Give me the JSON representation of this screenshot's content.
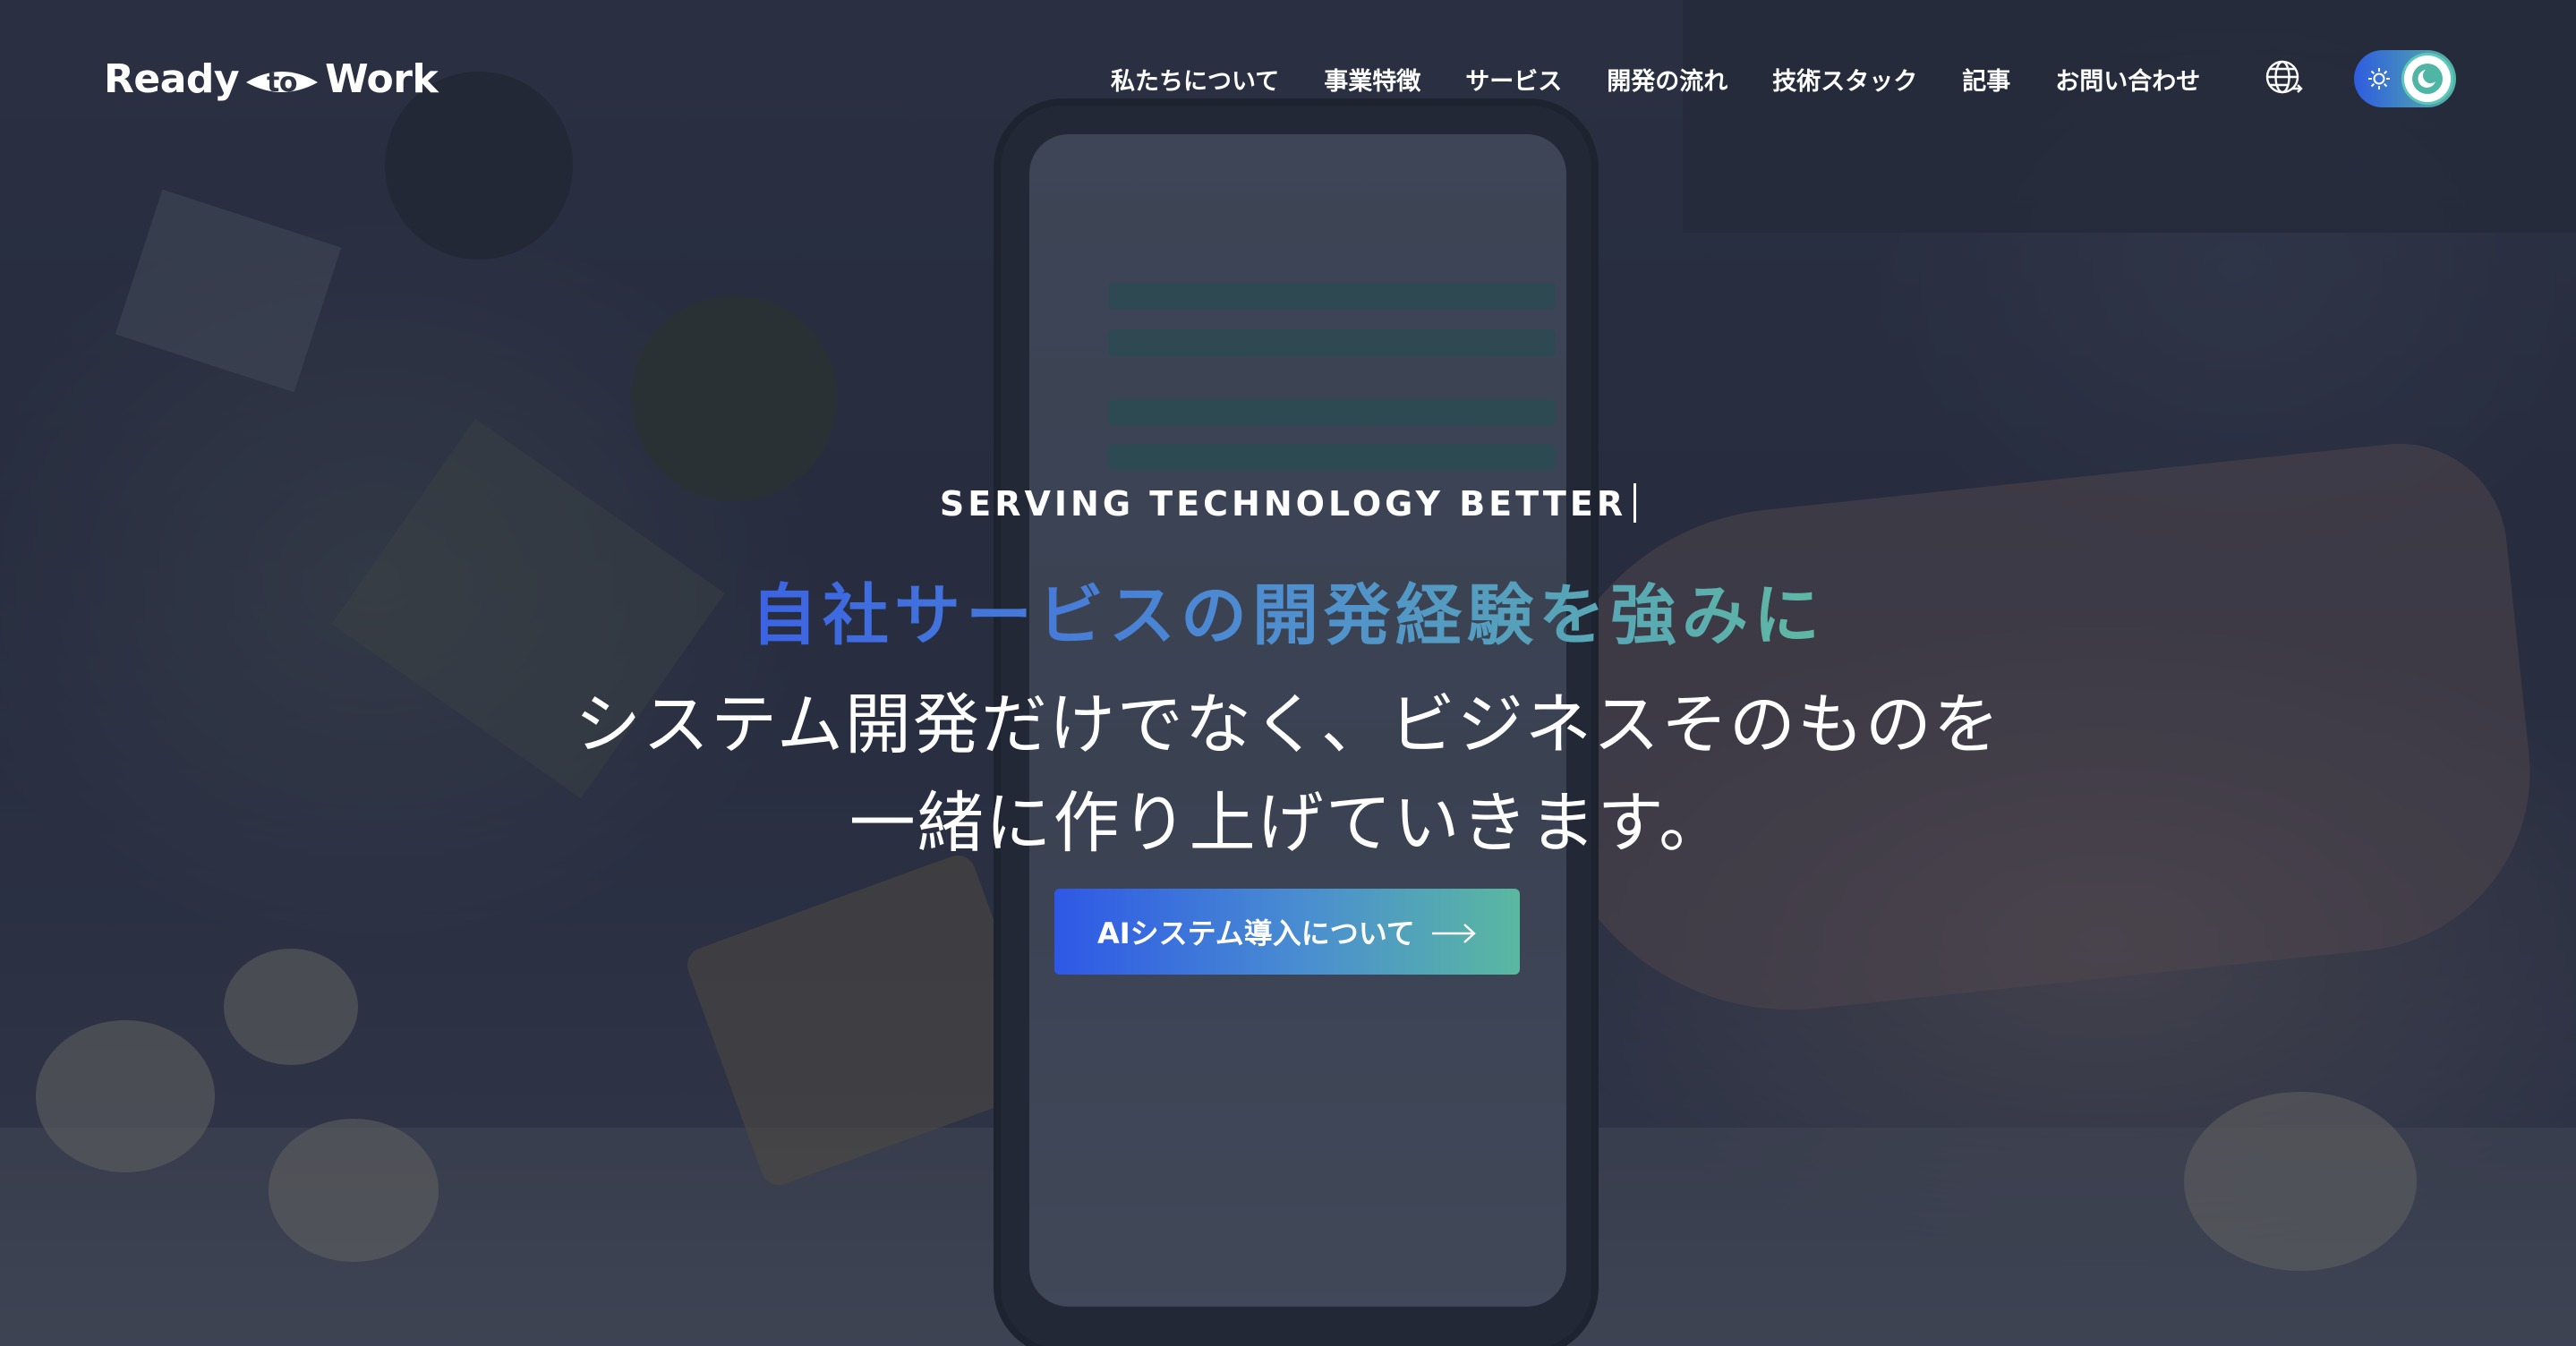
{
  "brand": {
    "name_left": "Ready",
    "name_mark": "to",
    "name_right": "Work"
  },
  "nav": {
    "items": [
      {
        "label": "私たちについて"
      },
      {
        "label": "事業特徴"
      },
      {
        "label": "サービス"
      },
      {
        "label": "開発の流れ"
      },
      {
        "label": "技術スタック"
      },
      {
        "label": "記事"
      },
      {
        "label": "お問い合わせ"
      }
    ],
    "language_icon": "globe-icon",
    "theme_toggle": {
      "light_icon": "sun-icon",
      "dark_icon": "moon-icon",
      "state": "dark"
    }
  },
  "hero": {
    "eyebrow": "SERVING TECHNOLOGY BETTER",
    "headline": "自社サービスの開発経験を強みに",
    "subline_1": "システム開発だけでなく、ビジネスそのものを",
    "subline_2": "一緒に作り上げていきます。",
    "cta_label": "AIシステム導入について",
    "cta_icon": "arrow-right-icon"
  },
  "colors": {
    "accent_blue": "#2e58e6",
    "accent_teal": "#5ab8a0",
    "overlay": "#1e2334"
  }
}
